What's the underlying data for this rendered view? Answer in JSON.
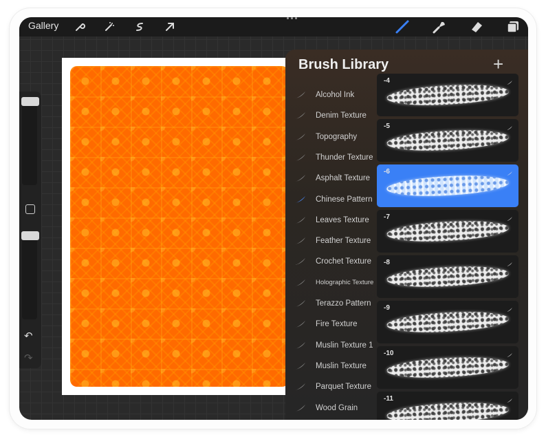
{
  "topbar": {
    "gallery_label": "Gallery",
    "left_icons": [
      "wrench-icon",
      "magic-wand-icon",
      "selection-s-icon",
      "arrow-transform-icon"
    ],
    "right_icons": [
      "brush-icon",
      "smudge-icon",
      "eraser-icon",
      "layers-icon"
    ],
    "active_tool_color": "#3a80f6"
  },
  "brush_library": {
    "title": "Brush Library",
    "add_label": "+",
    "categories": [
      {
        "label": "Alcohol Ink"
      },
      {
        "label": "Denim Texture"
      },
      {
        "label": "Topography"
      },
      {
        "label": "Thunder Texture"
      },
      {
        "label": "Asphalt Texture"
      },
      {
        "label": "Chinese Pattern",
        "selected": true
      },
      {
        "label": "Leaves Texture"
      },
      {
        "label": "Feather Texture"
      },
      {
        "label": "Crochet Texture"
      },
      {
        "label": "Holographic Texture"
      },
      {
        "label": "Terazzo Pattern"
      },
      {
        "label": "Fire Texture"
      },
      {
        "label": "Muslin Texture 1"
      },
      {
        "label": "Muslin Texture"
      },
      {
        "label": "Parquet Texture"
      },
      {
        "label": "Wood Grain"
      }
    ],
    "brushes": [
      {
        "name": "-4"
      },
      {
        "name": "-5"
      },
      {
        "name": "-6",
        "selected": true
      },
      {
        "name": "-7"
      },
      {
        "name": "-8"
      },
      {
        "name": "-9"
      },
      {
        "name": "-10"
      },
      {
        "name": "-11"
      }
    ]
  },
  "sidebar": {
    "undo_icon": "undo-icon",
    "redo_icon": "redo-icon"
  },
  "canvas": {
    "fill_color": "#ff6a00",
    "pattern_color": "#ffb020"
  }
}
